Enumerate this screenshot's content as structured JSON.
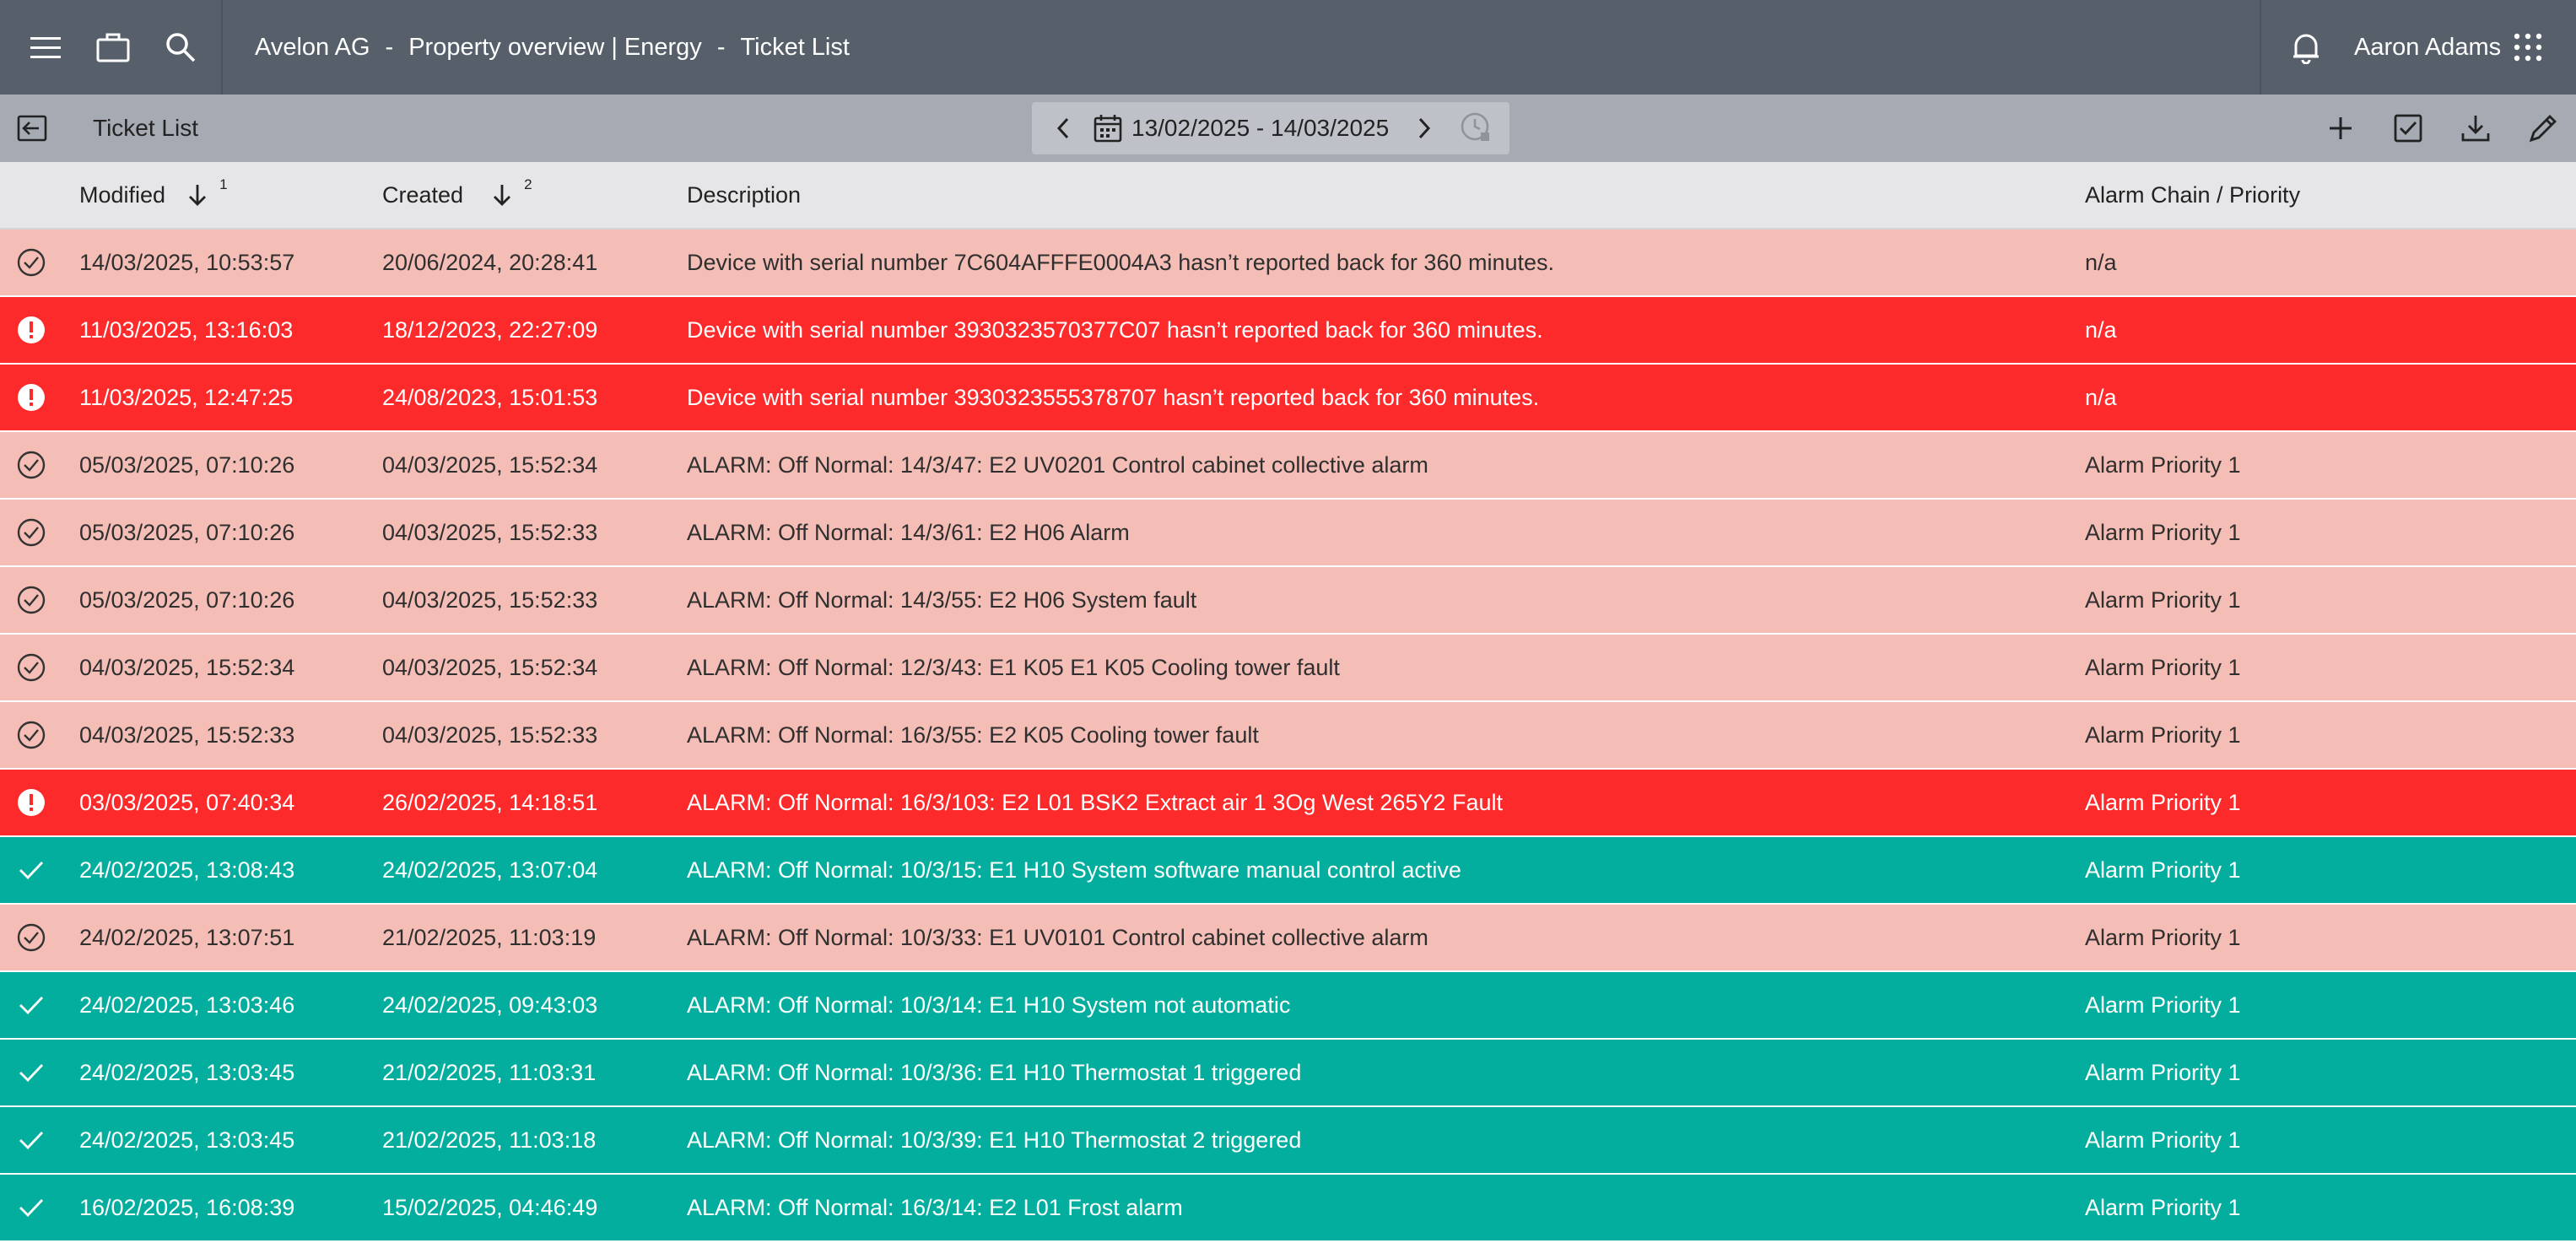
{
  "topbar": {
    "breadcrumb": [
      "Avelon AG",
      "Property overview | Energy",
      "Ticket List"
    ],
    "breadcrumb_separator": "-",
    "user_name": "Aaron Adams"
  },
  "toolbar": {
    "title": "Ticket List",
    "date_range": "13/02/2025 - 14/03/2025"
  },
  "table": {
    "columns": {
      "modified": "Modified",
      "modified_sort_order": "1",
      "created": "Created",
      "created_sort_order": "2",
      "description": "Description",
      "alarm_chain": "Alarm Chain / Priority"
    },
    "rows": [
      {
        "status": "acknowledged",
        "modified": "14/03/2025, 10:53:57",
        "created": "20/06/2024, 20:28:41",
        "description": "Device with serial number 7C604AFFFE0004A3 hasn’t reported back for 360 minutes.",
        "alarm_chain": "n/a"
      },
      {
        "status": "alarm",
        "modified": "11/03/2025, 13:16:03",
        "created": "18/12/2023, 22:27:09",
        "description": "Device with serial number 3930323570377C07 hasn’t reported back for 360 minutes.",
        "alarm_chain": "n/a"
      },
      {
        "status": "alarm",
        "modified": "11/03/2025, 12:47:25",
        "created": "24/08/2023, 15:01:53",
        "description": "Device with serial number 3930323555378707 hasn’t reported back for 360 minutes.",
        "alarm_chain": "n/a"
      },
      {
        "status": "acknowledged",
        "modified": "05/03/2025, 07:10:26",
        "created": "04/03/2025, 15:52:34",
        "description": "ALARM: Off Normal: 14/3/47: E2 UV0201 Control cabinet collective alarm",
        "alarm_chain": "Alarm Priority 1"
      },
      {
        "status": "acknowledged",
        "modified": "05/03/2025, 07:10:26",
        "created": "04/03/2025, 15:52:33",
        "description": "ALARM: Off Normal: 14/3/61: E2 H06 Alarm",
        "alarm_chain": "Alarm Priority 1"
      },
      {
        "status": "acknowledged",
        "modified": "05/03/2025, 07:10:26",
        "created": "04/03/2025, 15:52:33",
        "description": "ALARM: Off Normal: 14/3/55: E2 H06 System fault",
        "alarm_chain": "Alarm Priority 1"
      },
      {
        "status": "acknowledged",
        "modified": "04/03/2025, 15:52:34",
        "created": "04/03/2025, 15:52:34",
        "description": "ALARM: Off Normal: 12/3/43: E1 K05 E1 K05 Cooling tower fault",
        "alarm_chain": "Alarm Priority 1"
      },
      {
        "status": "acknowledged",
        "modified": "04/03/2025, 15:52:33",
        "created": "04/03/2025, 15:52:33",
        "description": "ALARM: Off Normal: 16/3/55: E2 K05 Cooling tower fault",
        "alarm_chain": "Alarm Priority 1"
      },
      {
        "status": "alarm",
        "modified": "03/03/2025, 07:40:34",
        "created": "26/02/2025, 14:18:51",
        "description": "ALARM: Off Normal: 16/3/103: E2 L01 BSK2 Extract air 1 3Og West 265Y2 Fault",
        "alarm_chain": "Alarm Priority 1"
      },
      {
        "status": "done",
        "modified": "24/02/2025, 13:08:43",
        "created": "24/02/2025, 13:07:04",
        "description": "ALARM: Off Normal: 10/3/15: E1 H10 System software manual control active",
        "alarm_chain": "Alarm Priority 1"
      },
      {
        "status": "acknowledged",
        "modified": "24/02/2025, 13:07:51",
        "created": "21/02/2025, 11:03:19",
        "description": "ALARM: Off Normal: 10/3/33: E1 UV0101 Control cabinet collective alarm",
        "alarm_chain": "Alarm Priority 1"
      },
      {
        "status": "done",
        "modified": "24/02/2025, 13:03:46",
        "created": "24/02/2025, 09:43:03",
        "description": "ALARM: Off Normal: 10/3/14: E1 H10 System not automatic",
        "alarm_chain": "Alarm Priority 1"
      },
      {
        "status": "done",
        "modified": "24/02/2025, 13:03:45",
        "created": "21/02/2025, 11:03:31",
        "description": "ALARM: Off Normal: 10/3/36: E1 H10 Thermostat 1 triggered",
        "alarm_chain": "Alarm Priority 1"
      },
      {
        "status": "done",
        "modified": "24/02/2025, 13:03:45",
        "created": "21/02/2025, 11:03:18",
        "description": "ALARM: Off Normal: 10/3/39: E1 H10 Thermostat 2 triggered",
        "alarm_chain": "Alarm Priority 1"
      },
      {
        "status": "done",
        "modified": "16/02/2025, 16:08:39",
        "created": "15/02/2025, 04:46:49",
        "description": "ALARM: Off Normal: 16/3/14: E2 L01 Frost alarm",
        "alarm_chain": "Alarm Priority 1"
      }
    ]
  },
  "colors": {
    "topbar": "#565f6a",
    "toolbar": "#a6abb3",
    "acknowledged_row": "#f4bdb6",
    "alarm_row": "#fc2a2a",
    "done_row": "#04ae9e"
  },
  "icons": [
    "menu-icon",
    "briefcase-icon",
    "search-icon",
    "bell-icon",
    "apps-grid-icon",
    "back-icon",
    "chevron-left-icon",
    "calendar-icon",
    "chevron-right-icon",
    "clock-icon",
    "add-icon",
    "checkbox-icon",
    "download-icon",
    "edit-icon",
    "sort-down-icon",
    "check-circle-icon",
    "alert-circle-icon",
    "check-icon"
  ]
}
